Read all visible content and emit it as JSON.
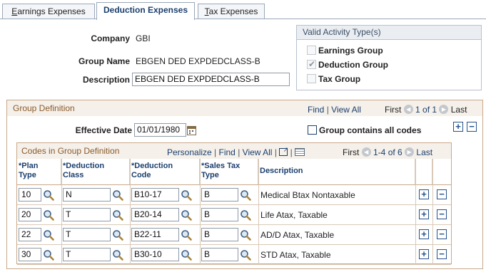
{
  "tabs": [
    {
      "label": "Earnings Expenses",
      "underline": "E",
      "rest": "arnings Expenses"
    },
    {
      "label": "Deduction Expenses"
    },
    {
      "label": "Tax Expenses",
      "underline": "T",
      "rest": "ax Expenses"
    }
  ],
  "header": {
    "company_label": "Company",
    "company_value": "GBI",
    "group_name_label": "Group Name",
    "group_name_value": "EBGEN DED EXPDEDCLASS-B",
    "description_label": "Description",
    "description_value": "EBGEN DED EXPDEDCLASS-B"
  },
  "valid_activity": {
    "title": "Valid Activity Type(s)",
    "items": [
      {
        "label": "Earnings Group",
        "checked": false
      },
      {
        "label": "Deduction Group",
        "checked": true
      },
      {
        "label": "Tax Group",
        "checked": false
      }
    ]
  },
  "group_definition": {
    "title": "Group Definition",
    "find": "Find",
    "view_all": "View All",
    "first": "First",
    "counter": "1 of 1",
    "last": "Last",
    "effective_date_label": "Effective Date",
    "effective_date_value": "01/01/1980",
    "all_codes_label": "Group contains all codes",
    "all_codes_checked": false
  },
  "codes_grid": {
    "title": "Codes in Group Definition",
    "personalize": "Personalize",
    "find": "Find",
    "view_all": "View All",
    "first": "First",
    "counter": "1-4 of 6",
    "last": "Last",
    "columns": [
      "*Plan Type",
      "*Deduction Class",
      "*Deduction Code",
      "*Sales Tax Type",
      "Description"
    ],
    "col_lines": [
      [
        "*Plan",
        "Type"
      ],
      [
        "*Deduction",
        "Class"
      ],
      [
        "*Deduction",
        "Code"
      ],
      [
        "*Sales Tax",
        "Type"
      ],
      [
        "Description",
        ""
      ]
    ],
    "rows": [
      {
        "plan_type": "10",
        "ded_class": "N",
        "ded_code": "B10-17",
        "sales_tax": "B",
        "description": "Medical Btax Nontaxable"
      },
      {
        "plan_type": "20",
        "ded_class": "T",
        "ded_code": "B20-14",
        "sales_tax": "B",
        "description": "Life Atax, Taxable"
      },
      {
        "plan_type": "22",
        "ded_class": "T",
        "ded_code": "B22-11",
        "sales_tax": "B",
        "description": "AD/D Atax, Taxable"
      },
      {
        "plan_type": "30",
        "ded_class": "T",
        "ded_code": "B30-10",
        "sales_tax": "B",
        "description": "STD Atax, Taxable"
      }
    ]
  },
  "icons": {
    "lookup": "magnifier-icon",
    "calendar": "calendar-icon",
    "add": "plus-icon",
    "delete": "minus-icon",
    "prev": "left-arrow-icon",
    "next": "right-arrow-icon"
  },
  "colors": {
    "accent_brown": "#8a5a2b",
    "link_blue": "#1b3f6d"
  }
}
